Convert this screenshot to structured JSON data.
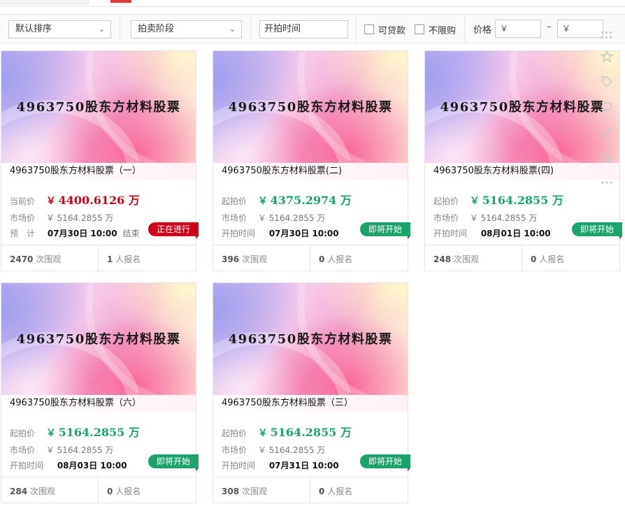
{
  "filters": {
    "sort_label": "默认排序",
    "stage_label": "拍卖阶段",
    "start_time_placeholder": "开拍时间",
    "loan_label": "可贷款",
    "unlimited_label": "不限购",
    "price_label": "价格",
    "price_min_placeholder": "￥",
    "price_max_placeholder": "￥",
    "price_dash": "–"
  },
  "thumbnail_text": "4963750股东方材料股票",
  "cards": [
    {
      "title": "4963750股东方材料股票（一）",
      "price_label": "当前价",
      "yen": "￥",
      "price": "4400.6126 万",
      "price_color": "red",
      "market_label": "市场价",
      "market_value": "￥ 5164.2855 万",
      "time_label": "预　计",
      "time_value": "07月30日 10:00",
      "time_suffix": "结束",
      "status": "正在进行",
      "status_color": "#d0021b",
      "views": "2470",
      "views_suffix": "次围观",
      "signups": "1",
      "signups_suffix": "人报名"
    },
    {
      "title": "4963750股东方材料股票(二)",
      "price_label": "起拍价",
      "yen": "￥",
      "price": "4375.2974 万",
      "price_color": "green",
      "market_label": "市场价",
      "market_value": "￥ 5164.2855 万",
      "time_label": "开拍时间",
      "time_value": "07月30日 10:00",
      "time_suffix": "",
      "status": "即将开始",
      "status_color": "#1aa36b",
      "views": "396",
      "views_suffix": "次围观",
      "signups": "0",
      "signups_suffix": "人报名"
    },
    {
      "title": "4963750股东方材料股票(四)",
      "price_label": "起拍价",
      "yen": "￥",
      "price": "5164.2855 万",
      "price_color": "green",
      "market_label": "市场价",
      "market_value": "￥ 5164.2855 万",
      "time_label": "开拍时间",
      "time_value": "08月01日 10:00",
      "time_suffix": "",
      "status": "即将开始",
      "status_color": "#1aa36b",
      "views": "248",
      "views_suffix": "次围观",
      "signups": "0",
      "signups_suffix": "人报名"
    },
    {
      "title": "4963750股东方材料股票（六）",
      "price_label": "起拍价",
      "yen": "￥",
      "price": "5164.2855 万",
      "price_color": "green",
      "market_label": "市场价",
      "market_value": "￥ 5164.2855 万",
      "time_label": "开拍时间",
      "time_value": "08月03日 10:00",
      "time_suffix": "",
      "status": "即将开始",
      "status_color": "#1aa36b",
      "views": "284",
      "views_suffix": "次围观",
      "signups": "0",
      "signups_suffix": "人报名"
    },
    {
      "title": "4963750股东方材料股票（三）",
      "price_label": "起拍价",
      "yen": "￥",
      "price": "5164.2855 万",
      "price_color": "green",
      "market_label": "市场价",
      "market_value": "￥ 5164.2855 万",
      "time_label": "开拍时间",
      "time_value": "07月31日 10:00",
      "time_suffix": "",
      "status": "即将开始",
      "status_color": "#1aa36b",
      "views": "308",
      "views_suffix": "次围观",
      "signups": "0",
      "signups_suffix": "人报名"
    }
  ],
  "side_tools": [
    "grid-icon",
    "star-icon",
    "tag-icon",
    "chat-icon",
    "brush-icon",
    "home-icon",
    "more-icon"
  ]
}
